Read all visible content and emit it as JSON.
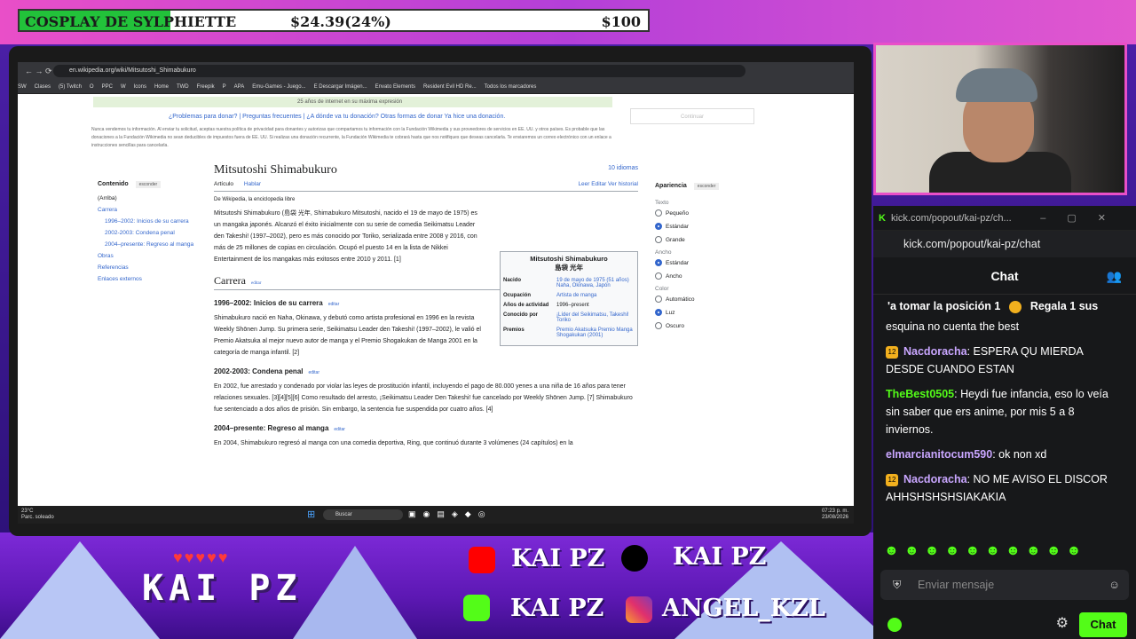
{
  "goal": {
    "title": "COSPLAY DE SYLPHIETTE",
    "amount": "$24.39(24%)",
    "target": "$100",
    "progress_fraction": 0.24
  },
  "browser": {
    "url": "en.wikipedia.org/wiki/Mitsutoshi_Shimabukuro",
    "bookmarks": [
      "SW",
      "Clases",
      "(5) Twitch",
      "O",
      "PPC",
      "W",
      "Icons",
      "Home",
      "TWD",
      "Freepik",
      "P",
      "APA",
      "Emu-Games - Juego...",
      "E Descargar Imágen...",
      "Envato Elements",
      "Resident Evil HD Re...",
      "Todos los marcadores"
    ]
  },
  "wiki": {
    "banner": "25 años de internet en su máxima expresión",
    "donate_links": "¿Problemas para donar? | Preguntas frecuentes | ¿A dónde va tu donación? Otras formas de donar Ya hice una donación.",
    "fine_print": "Nunca vendemos tu información. Al enviar tu solicitud, aceptas nuestra política de privacidad para donantes y autorizas que compartamos tu información con la Fundación Wikimedia y sus proveedores de servicios en EE. UU. y otros países. Es probable que las donaciones a la Fundación Wikimedia no sean deducibles de impuestos fuera de EE. UU. Si realizas una donación recurrente, la Fundación Wikimedia te cobrará hasta que nos notifiques que deseas cancelarla. Te enviaremos un correo electrónico con un enlace a instrucciones sencillas para cancelarla.",
    "right_button": "Continuar",
    "title": "Mitsutoshi Shimabukuro",
    "languages": "10 idiomas",
    "tab_article": "Artículo",
    "tab_talk": "Hablar",
    "actions": "Leer   Editar   Ver historial",
    "from": "De Wikipedia, la enciclopedia libre",
    "toc_head": "Contenido",
    "toc_hide": "esconder",
    "toc": [
      "(Arriba)",
      "Carrera",
      "1996–2002: Inicios de su carrera",
      "2002-2003: Condena penal",
      "2004–presente: Regreso al manga",
      "Obras",
      "Referencias",
      "Enlaces externos"
    ],
    "intro": "Mitsutoshi Shimabukuro (島袋 光年, Shimabukuro Mitsutoshi, nacido el 19 de mayo de 1975) es un mangaka japonés. Alcanzó el éxito inicialmente con su serie de comedia Seikimatsu Leader den Takeshi! (1997–2002), pero es más conocido por Toriko, serializada entre 2008 y 2016, con más de 25 millones de copias en circulación. Ocupó el puesto 14 en la lista de Nikkei Entertainment de los mangakas más exitosos entre 2010 y 2011. [1]",
    "h_carrera": "Carrera",
    "edit": "editar",
    "h_1996": "1996–2002: Inicios de su carrera",
    "p_1996": "Shimabukuro nació en Naha, Okinawa, y debutó como artista profesional en 1996 en la revista Weekly Shōnen Jump. Su primera serie, Seikimatsu Leader den Takeshi! (1997–2002), le valió el Premio Akatsuka al mejor nuevo autor de manga y el Premio Shogakukan de Manga 2001 en la categoría de manga infantil. [2]",
    "h_2002": "2002-2003: Condena penal",
    "p_2002": "En 2002, fue arrestado y condenado por violar las leyes de prostitución infantil, incluyendo el pago de 80.000 yenes a una niña de 16 años para tener relaciones sexuales. [3][4][5][6] Como resultado del arresto, ¡Seikimatsu Leader Den Takeshi! fue cancelado por Weekly Shōnen Jump. [7] Shimabukuro fue sentenciado a dos años de prisión. Sin embargo, la sentencia fue suspendida por cuatro años. [4]",
    "h_2004": "2004–presente: Regreso al manga",
    "p_2004": "En 2004, Shimabukuro regresó al manga con una comedia deportiva, Ring, que continuó durante 3 volúmenes (24 capítulos) en la",
    "infobox": {
      "title": "Mitsutoshi Shimabukuro",
      "title_jp": "島袋 光年",
      "rows": [
        {
          "k": "Nacido",
          "v": "19 de mayo de 1975 (51 años) Naha, Okinawa, Japón"
        },
        {
          "k": "Ocupación",
          "v": "Artista de manga"
        },
        {
          "k": "Años de actividad",
          "v": "1996–present"
        },
        {
          "k": "Conocido por",
          "v": "¡Líder del Seikimatsu, Takeshi! Toriko"
        },
        {
          "k": "Premios",
          "v": "Premio Akatsuka Premio Manga Shogakukan (2001)"
        }
      ]
    },
    "appear": {
      "head": "Apariencia",
      "hide": "esconder",
      "text_group": "Texto",
      "text_opts": [
        "Pequeño",
        "Estándar",
        "Grande"
      ],
      "width_group": "Ancho",
      "width_opts": [
        "Estándar",
        "Ancho"
      ],
      "color_group": "Color",
      "color_opts": [
        "Automático",
        "Luz",
        "Oscuro"
      ]
    }
  },
  "taskbar": {
    "weather_temp": "23°C",
    "weather_desc": "Parc. soleado",
    "search": "Buscar",
    "time": "07:23 p. m.",
    "date": "23/08/2026"
  },
  "cam": {
    "tag": "KICK"
  },
  "chat": {
    "window_title": "kick.com/popout/kai-pz/ch...",
    "url": "kick.com/popout/kai-pz/chat",
    "header": "Chat",
    "pinned_left": "'a tomar la posición 1",
    "pinned_right": "Regala 1 sus",
    "messages": [
      {
        "badge": "",
        "user": "",
        "text": "esquina no cuenta the best",
        "color": "#ffffff"
      },
      {
        "badge": "12",
        "user": "Nacdoracha",
        "text": ": ESPERA QU MIERDA DESDE CUANDO ESTAN",
        "color": "#c9a6ff"
      },
      {
        "badge": "",
        "user": "TheBest0505",
        "text": ": Heydi fue infancia, eso lo veía sin saber que ers anime, por mis 5 a 8 inviernos.",
        "color": "#53fc18"
      },
      {
        "badge": "",
        "user": "elmarcianitocum590",
        "text": ": ok non xd",
        "color": "#c9a6ff"
      },
      {
        "badge": "12",
        "user": "Nacdoracha",
        "text": ": NO ME AVISO EL DISCOR AHHSHSHSHSIAKAKIA",
        "color": "#c9a6ff"
      }
    ],
    "input_placeholder": "Enviar mensaje",
    "send_label": "Chat"
  },
  "branding": {
    "hearts": "♥♥♥♥♥",
    "name": "KAI PZ",
    "youtube": "KAI PZ",
    "tiktok": "KAI PZ",
    "kick": "KAI PZ",
    "instagram": "ANGEL_KZL"
  }
}
